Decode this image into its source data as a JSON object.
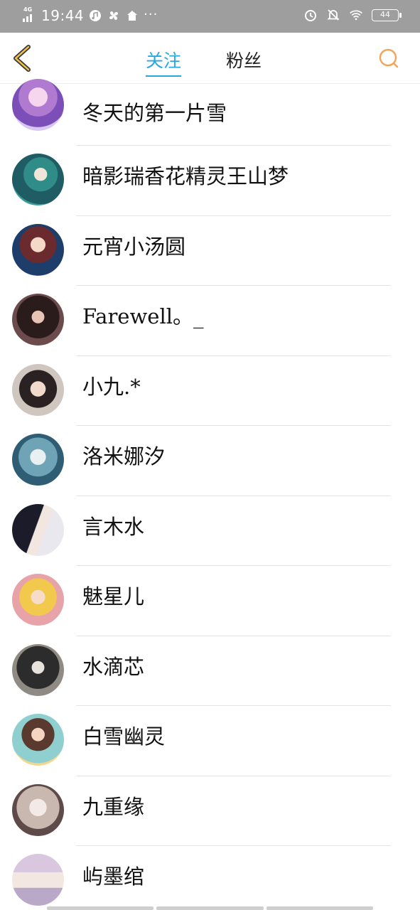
{
  "status_bar": {
    "network": "4G",
    "time": "19:44",
    "dots": "···",
    "battery": "44",
    "left_icons": [
      "music-note-icon",
      "pinwheel-icon",
      "home-icon"
    ],
    "right_icons": [
      "alarm-icon",
      "mute-bell-icon",
      "wifi-icon",
      "battery-icon"
    ]
  },
  "header": {
    "tabs": [
      {
        "label": "关注",
        "active": true
      },
      {
        "label": "粉丝",
        "active": false
      }
    ],
    "accent_color": "#29a8e0",
    "back_icon": "chevron-left-icon",
    "search_icon": "search-icon"
  },
  "users": [
    {
      "name": "冬天的第一片雪"
    },
    {
      "name": "暗影瑞香花精灵王山梦"
    },
    {
      "name": "元宵小汤圆"
    },
    {
      "name": "Farewell。_"
    },
    {
      "name": "小九.*"
    },
    {
      "name": "洛米娜汐"
    },
    {
      "name": "言木水"
    },
    {
      "name": "魅星儿"
    },
    {
      "name": "水滴芯"
    },
    {
      "name": "白雪幽灵"
    },
    {
      "name": "九重缘"
    },
    {
      "name": "屿墨绾"
    }
  ]
}
